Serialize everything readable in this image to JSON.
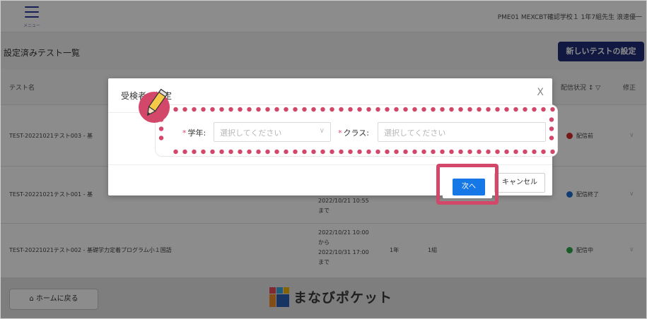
{
  "header": {
    "menu_label": "メニュー",
    "user_info": "PME01  MEXCBT確認学校１  1年7組先生 浪速優一"
  },
  "page": {
    "title": "設定済みテスト一覧",
    "new_test_button": "新しいテストの設定"
  },
  "table": {
    "columns": {
      "name": "テスト名",
      "status": "配信状況 ↕ ▽",
      "edit": "修正"
    },
    "rows": [
      {
        "name": "TEST-20221021テスト003 - 基",
        "status": "配信前",
        "status_color": "#d62a2a",
        "period": []
      },
      {
        "name": "TEST-20221021テスト001 - 基",
        "status": "配信終了",
        "status_color": "#1f6fd6",
        "period": [
          "2022/10/21 10:55",
          "まで"
        ]
      },
      {
        "name": "TEST-20221021テスト002 - 基礎学力定着プログラム小１国語",
        "status": "配信中",
        "status_color": "#2ea84a",
        "period": [
          "2022/10/21 10:00",
          "から",
          "2022/10/31 17:00",
          "まで"
        ],
        "grade": "1年",
        "class": "1組"
      }
    ]
  },
  "footer": {
    "home_button": "⌂ ホームに戻る",
    "logo_text": "まなびポケット"
  },
  "modal": {
    "title": "受検者の指定",
    "close_icon": "X",
    "grade_label": "学年:",
    "grade_placeholder": "選択してください",
    "class_label": "クラス:",
    "class_placeholder": "選択してください",
    "required_mark": "*",
    "next_button": "次へ",
    "cancel_button": "キャンセル"
  },
  "colors": {
    "accent": "#1677e6",
    "brand": "#1f2e7a",
    "highlight": "#d2476a"
  }
}
